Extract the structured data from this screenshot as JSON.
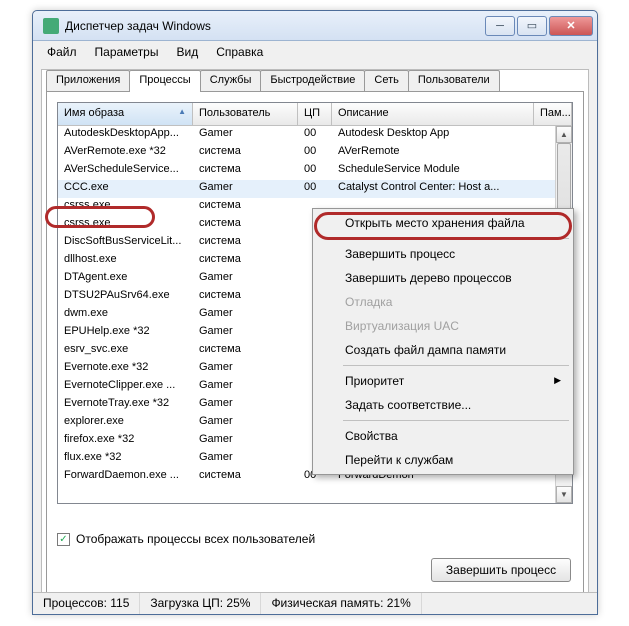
{
  "window": {
    "title": "Диспетчер задач Windows"
  },
  "menu": {
    "file": "Файл",
    "options": "Параметры",
    "view": "Вид",
    "help": "Справка"
  },
  "tabs": {
    "apps": "Приложения",
    "processes": "Процессы",
    "services": "Службы",
    "perf": "Быстродействие",
    "net": "Сеть",
    "users": "Пользователи"
  },
  "cols": {
    "image": "Имя образа",
    "user": "Пользователь",
    "cpu": "ЦП",
    "desc": "Описание",
    "mem": "Пам..."
  },
  "rows": [
    {
      "img": "AutodeskDesktopApp...",
      "user": "Gamer",
      "cpu": "00",
      "desc": "Autodesk Desktop App"
    },
    {
      "img": "AVerRemote.exe *32",
      "user": "система",
      "cpu": "00",
      "desc": "AVerRemote"
    },
    {
      "img": "AVerScheduleService...",
      "user": "система",
      "cpu": "00",
      "desc": "ScheduleService Module"
    },
    {
      "img": "CCC.exe",
      "user": "Gamer",
      "cpu": "00",
      "desc": "Catalyst Control Center: Host a..."
    },
    {
      "img": "csrss.exe",
      "user": "система",
      "cpu": "",
      "desc": ""
    },
    {
      "img": "csrss.exe",
      "user": "система",
      "cpu": "",
      "desc": ""
    },
    {
      "img": "DiscSoftBusServiceLit...",
      "user": "система",
      "cpu": "",
      "desc": ""
    },
    {
      "img": "dllhost.exe",
      "user": "система",
      "cpu": "",
      "desc": ""
    },
    {
      "img": "DTAgent.exe",
      "user": "Gamer",
      "cpu": "",
      "desc": ""
    },
    {
      "img": "DTSU2PAuSrv64.exe",
      "user": "система",
      "cpu": "",
      "desc": ""
    },
    {
      "img": "dwm.exe",
      "user": "Gamer",
      "cpu": "",
      "desc": ""
    },
    {
      "img": "EPUHelp.exe *32",
      "user": "Gamer",
      "cpu": "",
      "desc": ""
    },
    {
      "img": "esrv_svc.exe",
      "user": "система",
      "cpu": "",
      "desc": ""
    },
    {
      "img": "Evernote.exe *32",
      "user": "Gamer",
      "cpu": "",
      "desc": ""
    },
    {
      "img": "EvernoteClipper.exe ...",
      "user": "Gamer",
      "cpu": "",
      "desc": ""
    },
    {
      "img": "EvernoteTray.exe *32",
      "user": "Gamer",
      "cpu": "",
      "desc": ""
    },
    {
      "img": "explorer.exe",
      "user": "Gamer",
      "cpu": "",
      "desc": ""
    },
    {
      "img": "firefox.exe *32",
      "user": "Gamer",
      "cpu": "",
      "desc": ""
    },
    {
      "img": "flux.exe *32",
      "user": "Gamer",
      "cpu": "",
      "desc": ""
    },
    {
      "img": "ForwardDaemon.exe ...",
      "user": "система",
      "cpu": "00",
      "desc": "ForwardDemon"
    }
  ],
  "checkbox": {
    "checked": true,
    "label": "Отображать процессы всех пользователей"
  },
  "endbtn": "Завершить процесс",
  "status": {
    "procs": "Процессов: 115",
    "cpu": "Загрузка ЦП: 25%",
    "mem": "Физическая память: 21%"
  },
  "ctx": {
    "open_loc": "Открыть место хранения файла",
    "end_proc": "Завершить процесс",
    "end_tree": "Завершить дерево процессов",
    "debug": "Отладка",
    "uac": "Виртуализация UAC",
    "dump": "Создать файл дампа памяти",
    "priority": "Приоритет",
    "affinity": "Задать соответствие...",
    "props": "Свойства",
    "goto": "Перейти к службам"
  }
}
